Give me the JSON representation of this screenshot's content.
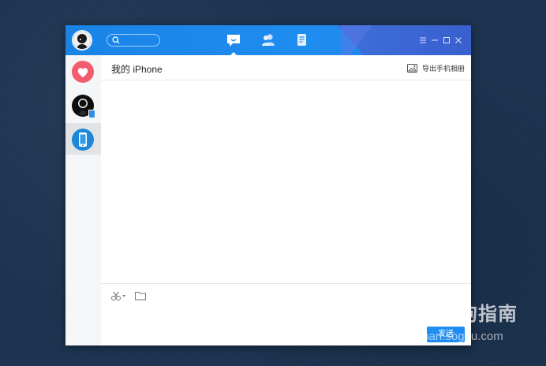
{
  "colors": {
    "titlebar": "#1f8cf0",
    "accent": "#1f8cf0",
    "favorite": "#f25c6c",
    "device": "#1e88d8",
    "sidebar_bg": "#f5f6f8",
    "active_item": "#e1e3e6"
  },
  "titlebar": {
    "nav": [
      {
        "icon": "message-icon",
        "active": true
      },
      {
        "icon": "contacts-icon",
        "active": false
      },
      {
        "icon": "file-icon",
        "active": false
      }
    ],
    "controls": [
      "menu-icon",
      "minimize-icon",
      "maximize-icon",
      "close-icon"
    ]
  },
  "sidebar": {
    "items": [
      {
        "icon": "heart-icon"
      },
      {
        "icon": "avatar"
      },
      {
        "icon": "phone-icon",
        "active": true
      }
    ]
  },
  "chat": {
    "title": "我的 iPhone",
    "export_label": "导出手机相册"
  },
  "composer": {
    "tools": [
      "scissors-icon",
      "folder-icon"
    ],
    "send_label": "发送"
  },
  "watermark": {
    "text": "搜狗指南",
    "url": "zhinan.sogou.com"
  }
}
